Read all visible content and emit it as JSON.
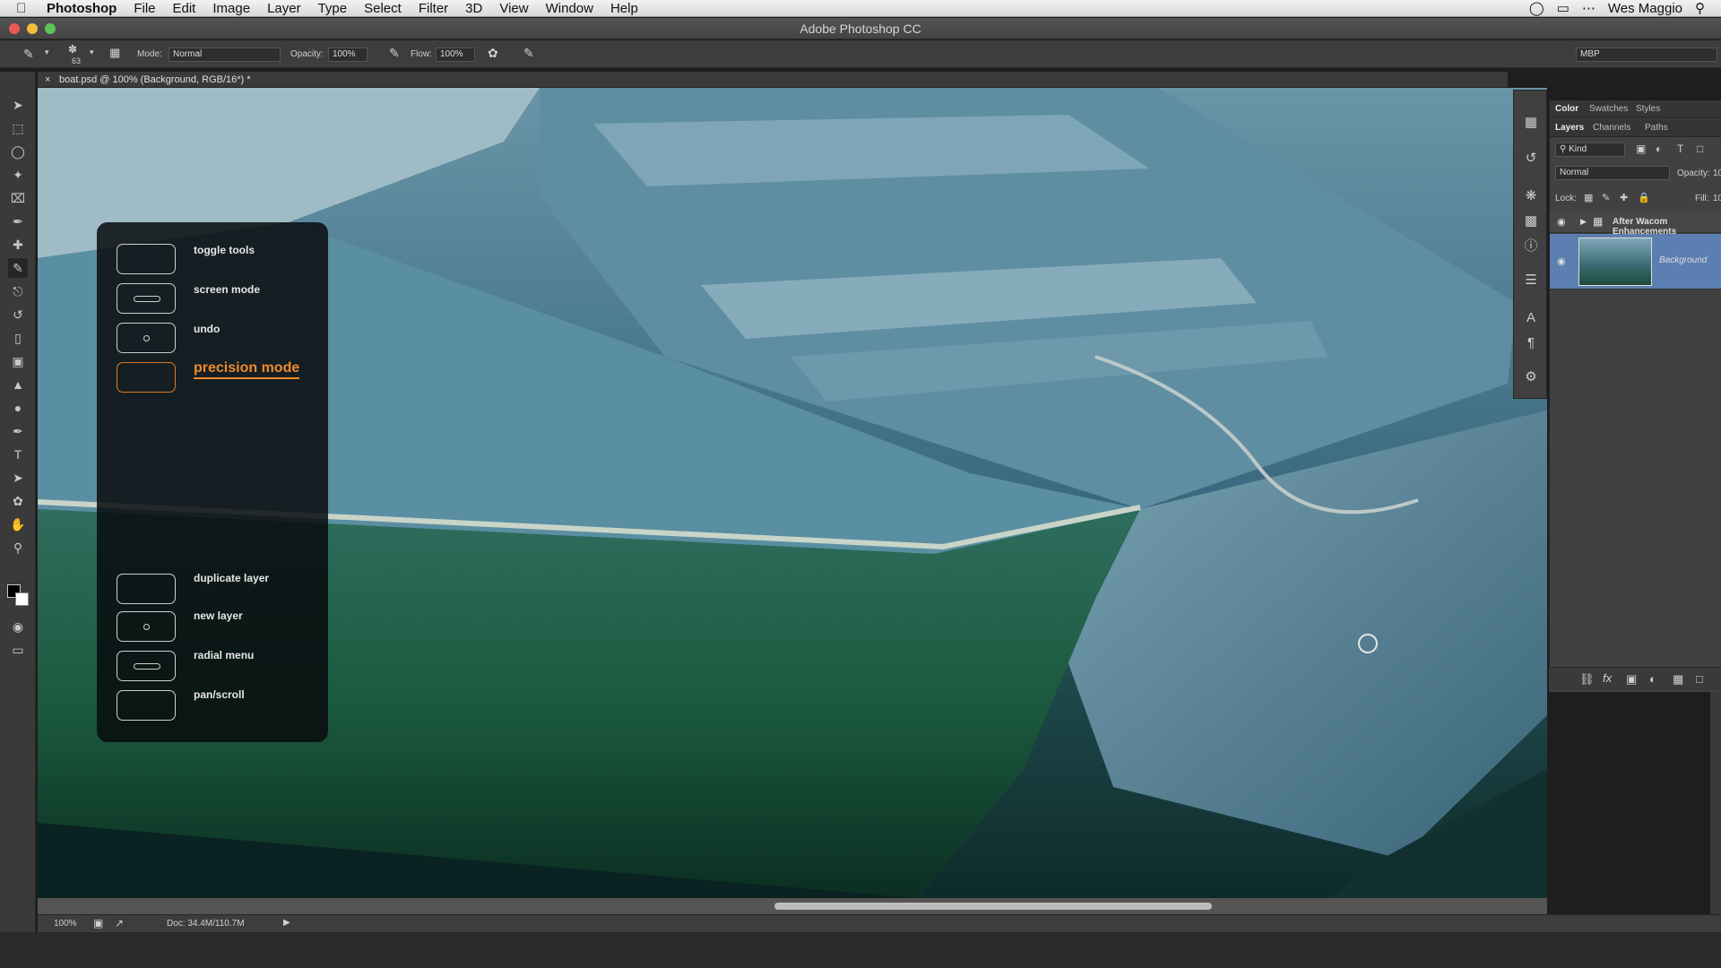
{
  "menubar": {
    "app_name": "Photoshop",
    "items": [
      "File",
      "Edit",
      "Image",
      "Layer",
      "Type",
      "Select",
      "Filter",
      "3D",
      "View",
      "Window",
      "Help"
    ],
    "user": "Wes Maggio"
  },
  "window": {
    "title": "Adobe Photoshop CC"
  },
  "options": {
    "brush_size": "63",
    "mode_label": "Mode:",
    "mode_value": "Normal",
    "opacity_label": "Opacity:",
    "opacity_value": "100%",
    "flow_label": "Flow:",
    "flow_value": "100%",
    "workspace": "MBP"
  },
  "document": {
    "tab_title": "boat.psd @ 100% (Background, RGB/16*) *",
    "zoom": "100%",
    "doc_size": "Doc: 34.4M/110.7M"
  },
  "panels": {
    "top_tabs": [
      "Color",
      "Swatches",
      "Styles"
    ],
    "layer_tabs": [
      "Layers",
      "Channels",
      "Paths"
    ],
    "kind_label": "Kind",
    "blend_mode": "Normal",
    "opacity_label": "Opacity:",
    "opacity_value": "10",
    "lock_label": "Lock:",
    "fill_label": "Fill:",
    "fill_value": "10",
    "layers": [
      {
        "name": "After Wacom Enhancements",
        "type": "group"
      },
      {
        "name": "Background",
        "type": "image"
      }
    ]
  },
  "wacom_menu": {
    "top": [
      {
        "label": "toggle tools",
        "icon": "none"
      },
      {
        "label": "screen mode",
        "icon": "bar"
      },
      {
        "label": "undo",
        "icon": "dot"
      },
      {
        "label": "precision mode",
        "icon": "none",
        "active": true
      }
    ],
    "bottom": [
      {
        "label": "duplicate layer",
        "icon": "none"
      },
      {
        "label": "new layer",
        "icon": "dot"
      },
      {
        "label": "radial menu",
        "icon": "bar"
      },
      {
        "label": "pan/scroll",
        "icon": "none"
      }
    ],
    "accent_color": "#ef8a2a"
  }
}
